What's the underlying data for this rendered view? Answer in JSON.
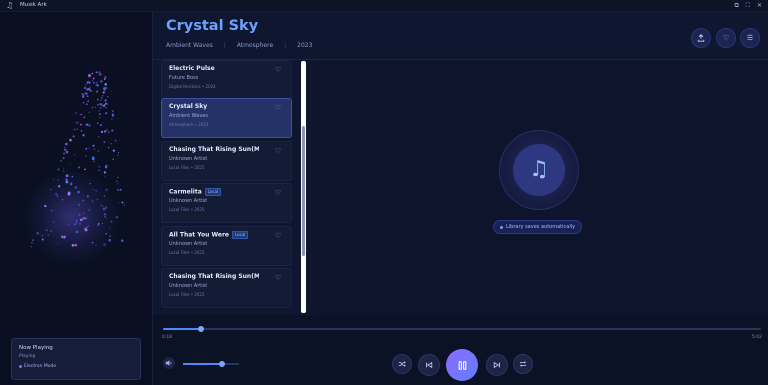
{
  "window": {
    "title": "Musik Ark",
    "app_icon": "music-note-icon",
    "controls": [
      "restore-icon",
      "maximize-icon",
      "close-icon"
    ]
  },
  "header": {
    "title": "Crystal Sky",
    "artist": "Ambient Waves",
    "album": "Atmosphere",
    "year": "2023",
    "buttons": [
      "upload-icon",
      "heart-icon",
      "list-icon"
    ]
  },
  "tracks": [
    {
      "title": "Electric Pulse",
      "artist": "Future Boss",
      "sub": "Digital Horizons • 2024",
      "badge": "",
      "active": false
    },
    {
      "title": "Crystal Sky",
      "artist": "Ambient Waves",
      "sub": "Atmosphere • 2023",
      "badge": "",
      "active": true
    },
    {
      "title": "Chasing That Rising Sun(Ma",
      "artist": "Unknown Artist",
      "sub": "Local Files • 2025",
      "badge": "",
      "active": false
    },
    {
      "title": "Carmelita",
      "artist": "Unknown Artist",
      "sub": "Local Files • 2025",
      "badge": "Local",
      "active": false
    },
    {
      "title": "All That You Were",
      "artist": "Unknown Artist",
      "sub": "Local Files • 2025",
      "badge": "Local",
      "active": false
    },
    {
      "title": "Chasing That Rising Sun(Ma",
      "artist": "Unknown Artist",
      "sub": "Local Files • 2025",
      "badge": "",
      "active": false
    }
  ],
  "artwork": {
    "placeholder_icon": "music-note-icon"
  },
  "status_pill": "Library saves automatically",
  "now_playing": {
    "title": "Now Playing",
    "status": "Playing",
    "mode": "Electron Mode"
  },
  "playback": {
    "elapsed": "0:18",
    "duration": "5:02",
    "progress_fraction": 0.064,
    "volume_fraction": 0.7,
    "buttons": [
      "shuffle-icon",
      "previous-icon",
      "pause-icon",
      "next-icon",
      "repeat-icon"
    ]
  },
  "colors": {
    "accent": "#6ea0ff",
    "play_gradient_start": "#8e6bff",
    "play_gradient_end": "#5f7dff",
    "background": "#0f1730"
  }
}
